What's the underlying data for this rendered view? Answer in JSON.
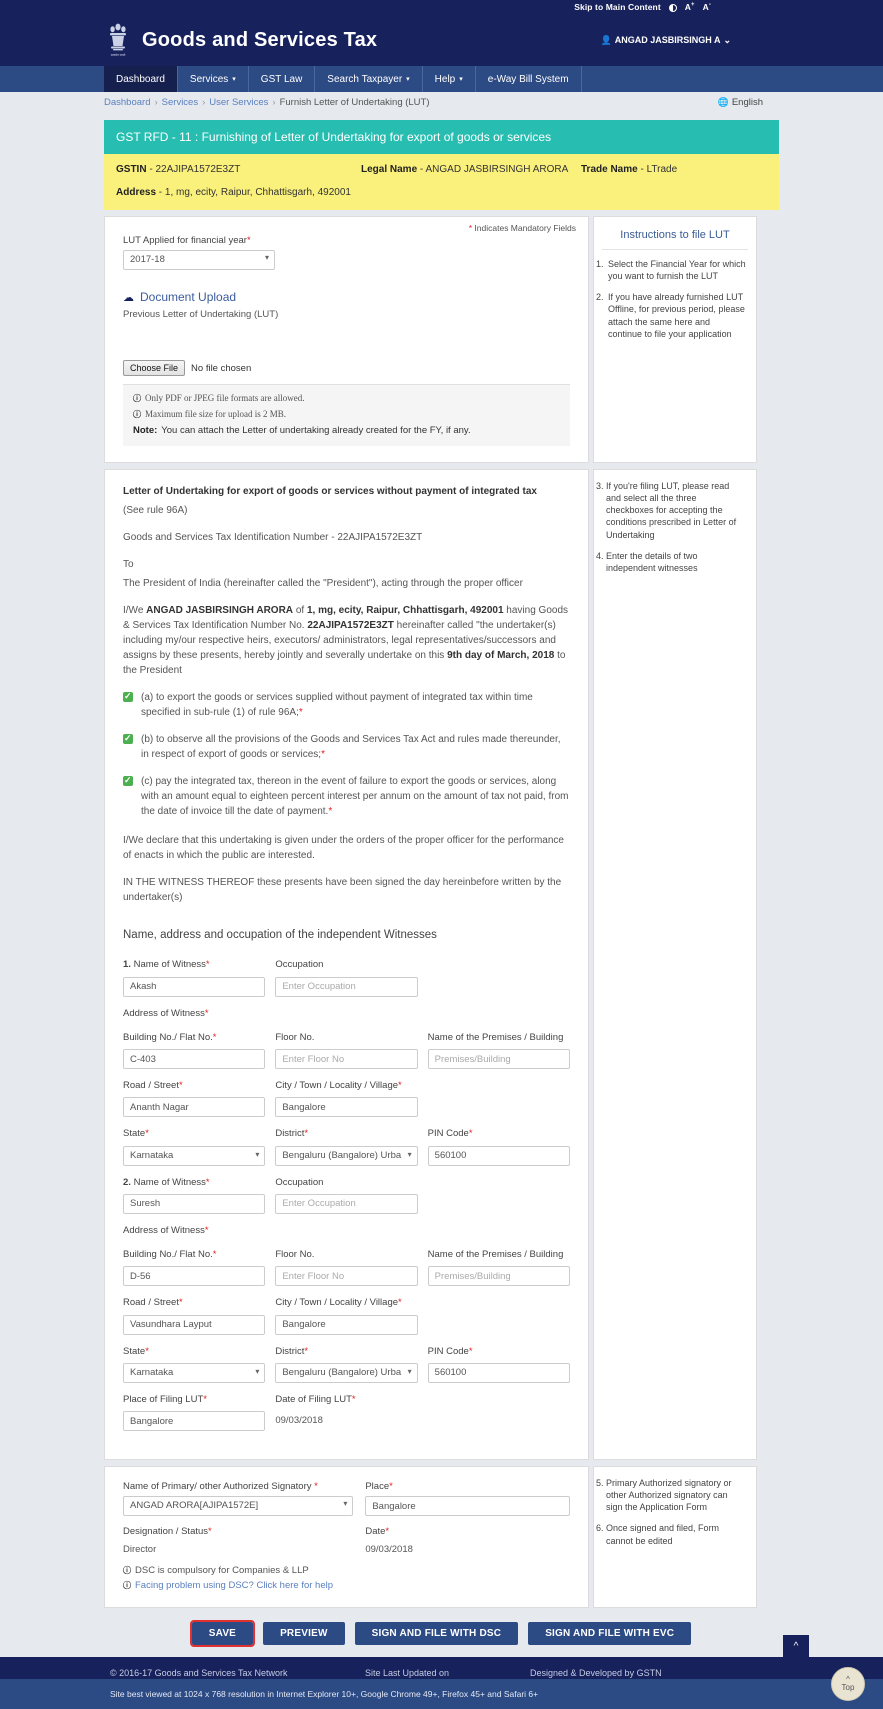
{
  "utility": {
    "skip": "Skip to Main Content",
    "contrast_icon": "contrast-icon",
    "font_increase": "A",
    "font_increase_sup": "+",
    "font_decrease": "A",
    "font_decrease_sup": "-"
  },
  "header": {
    "emblem_icon": "india-emblem-icon",
    "title": "Goods and Services Tax",
    "user_icon": "user-icon",
    "user_name": "ANGAD JASBIRSINGH A",
    "user_caret": "⌄"
  },
  "nav": {
    "items": [
      {
        "label": "Dashboard",
        "has_caret": false
      },
      {
        "label": "Services",
        "has_caret": true
      },
      {
        "label": "GST Law",
        "has_caret": false
      },
      {
        "label": "Search Taxpayer",
        "has_caret": true
      },
      {
        "label": "Help",
        "has_caret": true
      },
      {
        "label": "e-Way Bill System",
        "has_caret": false
      }
    ]
  },
  "breadcrumb": {
    "items": [
      "Dashboard",
      "Services",
      "User Services"
    ],
    "current": "Furnish Letter of Undertaking (LUT)",
    "separator": "›",
    "language": "English",
    "globe_icon": "globe-icon"
  },
  "banner": {
    "title": "GST RFD - 11 : Furnishing of Letter of Undertaking for export of goods or services"
  },
  "taxpayer": {
    "gstin_label": "GSTIN",
    "gstin_value": "22AJIPA1572E3ZT",
    "legal_name_label": "Legal Name",
    "legal_name_value": "ANGAD JASBIRSINGH ARORA",
    "trade_name_label": "Trade Name",
    "trade_name_value": "LTrade",
    "address_label": "Address",
    "address_value": "1, mg, ecity, Raipur, Chhattisgarh, 492001",
    "dash": "-"
  },
  "form_top": {
    "mandatory_note": "Indicates Mandatory Fields",
    "fy_label": "LUT Applied for financial year",
    "fy_value": "2017-18",
    "doc_upload_title": "Document Upload",
    "cloud_icon": "cloud-upload-icon",
    "doc_upload_sub": "Previous Letter of Undertaking (LUT)",
    "choose_file_label": "Choose File",
    "no_file_text": "No file chosen",
    "note_1": "Only PDF or JPEG file formats are allowed.",
    "note_2": "Maximum file size for upload is 2 MB.",
    "note_3_bold": "Note:",
    "note_3": "You can attach the Letter of undertaking already created for the FY, if any."
  },
  "instructions": {
    "title": "Instructions to file LUT",
    "group1": [
      "Select the Financial Year for which you want to furnish the LUT",
      "If you have already furnished LUT Offline, for previous period, please attach the same here and continue to file your application"
    ],
    "group2": [
      "If you're filing LUT, please read and select all the three checkboxes for accepting the conditions prescribed in Letter of Undertaking",
      "Enter the details of two independent witnesses"
    ],
    "group3": [
      "Primary Authorized signatory or other Authorized signatory can sign the Application Form",
      "Once signed and filed, Form cannot be edited"
    ]
  },
  "lut": {
    "heading": "Letter of Undertaking for export of goods or services without payment of integrated tax",
    "rule": "(See rule 96A)",
    "gstin_line": "Goods and Services Tax Identification Number - 22AJIPA1572E3ZT",
    "to": "To",
    "president_line": "The President of India (hereinafter called the \"President\"), acting through the proper officer",
    "body_prefix": "I/We",
    "body_name": "ANGAD JASBIRSINGH ARORA",
    "body_of": "of",
    "body_address": "1, mg, ecity, Raipur, Chhattisgarh, 492001",
    "body_having": "having Goods & Services Tax Identification Number No.",
    "body_gstin": "22AJIPA1572E3ZT",
    "body_mid": "hereinafter called \"the undertaker(s) including my/our respective heirs, executors/ administrators, legal representatives/successors and assigns by these presents, hereby jointly and severally undertake on this",
    "body_date": "9th day of March, 2018",
    "body_suffix": "to the President",
    "checkbox_a": "(a) to export the goods or services supplied without payment of integrated tax within time specified in sub-rule (1) of rule 96A;",
    "checkbox_b": "(b) to observe all the provisions of the Goods and Services Tax Act and rules made thereunder, in respect of export of goods or services;",
    "checkbox_c": "(c) pay the integrated tax, thereon in the event of failure to export the goods or services, along with an amount equal to eighteen percent interest per annum on the amount of tax not paid, from the date of invoice till the date of payment.",
    "declare": "I/We declare that this undertaking is given under the orders of the proper officer for the performance of enacts in which the public are interested.",
    "witness_thereof": "IN THE WITNESS THEREOF these presents have been signed the day hereinbefore written by the undertaker(s)",
    "witness_heading": "Name, address and occupation of the independent Witnesses"
  },
  "labels": {
    "name_of_witness": "Name of Witness",
    "occupation": "Occupation",
    "address_of_witness": "Address of Witness",
    "building_no": "Building No./ Flat No.",
    "floor_no": "Floor No.",
    "premises": "Name of the Premises / Building",
    "road_street": "Road / Street",
    "city": "City / Town / Locality / Village",
    "state": "State",
    "district": "District",
    "pin_code": "PIN Code",
    "place_of_filing": "Place of Filing LUT",
    "date_of_filing": "Date of Filing LUT",
    "signatory_name": "Name of Primary/ other Authorized Signatory",
    "place": "Place",
    "designation": "Designation / Status",
    "date": "Date"
  },
  "placeholders": {
    "occupation": "Enter Occupation",
    "floor_no": "Enter Floor No",
    "premises": "Premises/Building"
  },
  "witnesses": [
    {
      "index": "1.",
      "name": "Akash",
      "occupation": "",
      "building": "C-403",
      "floor": "",
      "premises": "",
      "road": "Ananth Nagar",
      "city": "Bangalore",
      "state": "Karnataka",
      "district": "Bengaluru (Bangalore) Urba",
      "pin": "560100"
    },
    {
      "index": "2.",
      "name": "Suresh",
      "occupation": "",
      "building": "D-56",
      "floor": "",
      "premises": "",
      "road": "Vasundhara Layput",
      "city": "Bangalore",
      "state": "Karnataka",
      "district": "Bengaluru (Bangalore) Urba",
      "pin": "560100"
    }
  ],
  "filing": {
    "place_value": "Bangalore",
    "date_value": "09/03/2018"
  },
  "signatory": {
    "name_value": "ANGAD ARORA[AJIPA1572E]",
    "place_value": "Bangalore",
    "designation_value": "Director",
    "date_value": "09/03/2018",
    "dsc_note": "DSC is compulsory for Companies & LLP",
    "dsc_help_prefix": "Facing problem using DSC?",
    "dsc_help_link": "Click here for help"
  },
  "buttons": {
    "save": "SAVE",
    "preview": "PREVIEW",
    "sign_dsc": "SIGN AND FILE WITH DSC",
    "sign_evc": "SIGN AND FILE WITH EVC",
    "focus_color": "#e03030"
  },
  "footer": {
    "copyright": "© 2016-17 Goods and Services Tax Network",
    "last_updated": "Site Last Updated on",
    "designed_by": "Designed & Developed by GSTN",
    "best_viewed": "Site best viewed at 1024 x 768 resolution in Internet Explorer 10+, Google Chrome 49+, Firefox 45+ and Safari 6+",
    "scroll_tab_icon": "chevron-up-icon",
    "top_icon": "chevron-up-icon",
    "top_label": "Top"
  },
  "colors": {
    "navy": "#17215c",
    "nav_blue": "#2c4a84",
    "teal": "#27bdb0",
    "yellow": "#faf07c",
    "checkbox_green": "#4caf50"
  }
}
